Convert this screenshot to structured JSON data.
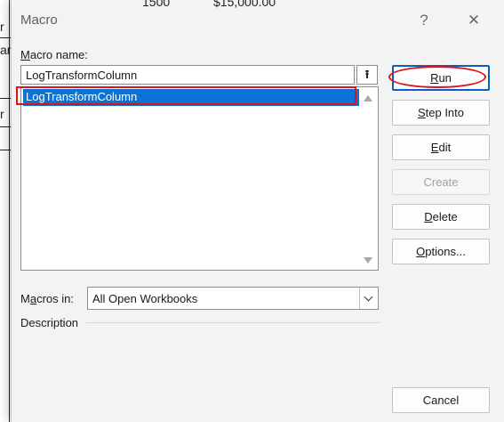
{
  "sheet": {
    "fragments": [
      "r",
      "arc",
      "r",
      "1500",
      "$15,000.00"
    ]
  },
  "dialog": {
    "title": "Macro",
    "help_glyph": "?",
    "close_glyph": "✕",
    "macro_name_label_prefix": "",
    "macro_name_label_hotkey": "M",
    "macro_name_label_rest": "acro name:",
    "macro_name_value": "LogTransformColumn",
    "macro_list": [
      "LogTransformColumn"
    ],
    "macros_in_label_prefix": "M",
    "macros_in_label_hotkey": "a",
    "macros_in_label_rest": "cros in:",
    "macros_in_value": "All Open Workbooks",
    "description_label": "Description",
    "buttons": {
      "run": {
        "hotkey": "R",
        "rest": "un"
      },
      "step_into": {
        "hotkey": "S",
        "rest": "tep Into"
      },
      "edit": {
        "hotkey": "E",
        "rest": "dit"
      },
      "create": "Create",
      "delete": {
        "hotkey": "D",
        "rest": "elete"
      },
      "options": {
        "hotkey": "O",
        "rest": "ptions..."
      },
      "cancel": "Cancel"
    }
  },
  "colors": {
    "selection": "#0a74d6",
    "annotation_red": "#d9141b"
  }
}
